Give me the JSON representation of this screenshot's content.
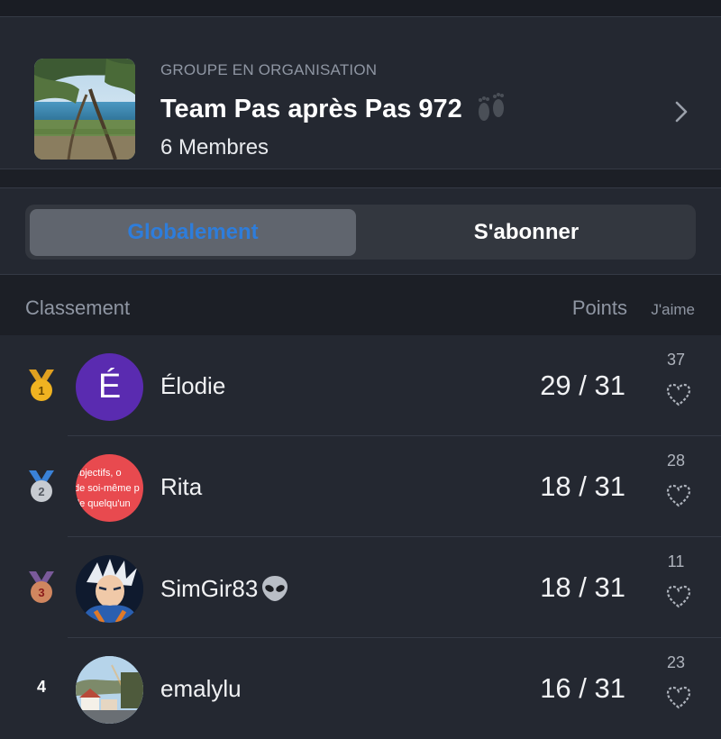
{
  "group": {
    "kicker": "GROUPE EN ORGANISATION",
    "title": "Team Pas après Pas 972",
    "members": "6 Membres",
    "title_icon": "footprints-icon"
  },
  "tabs": {
    "active": "Globalement",
    "inactive": "S'abonner"
  },
  "table": {
    "rank_header": "Classement",
    "points_header": "Points",
    "likes_header": "J'aime"
  },
  "rows": [
    {
      "rank": "1",
      "medal": "gold",
      "avatar_letter": "É",
      "name": "Élodie",
      "score": "29 / 31",
      "likes": "37"
    },
    {
      "rank": "2",
      "medal": "silver",
      "avatar_text": [
        "objectifs, o",
        "de soi-même p",
        "de quelqu'un"
      ],
      "name": "Rita",
      "score": "18 / 31",
      "likes": "28"
    },
    {
      "rank": "3",
      "medal": "bronze",
      "name": "SimGir83",
      "name_icon": "alien-icon",
      "score": "18 / 31",
      "likes": "11"
    },
    {
      "rank": "4",
      "name": "emalylu",
      "score": "16 / 31",
      "likes": "23"
    }
  ],
  "colors": {
    "accent": "#2e7ddb",
    "gold": "#f0b321",
    "silver": "#c7cbd1",
    "bronze": "#d0865f",
    "avatar_purple": "#5a2bb0",
    "avatar_red": "#e84a4f"
  }
}
